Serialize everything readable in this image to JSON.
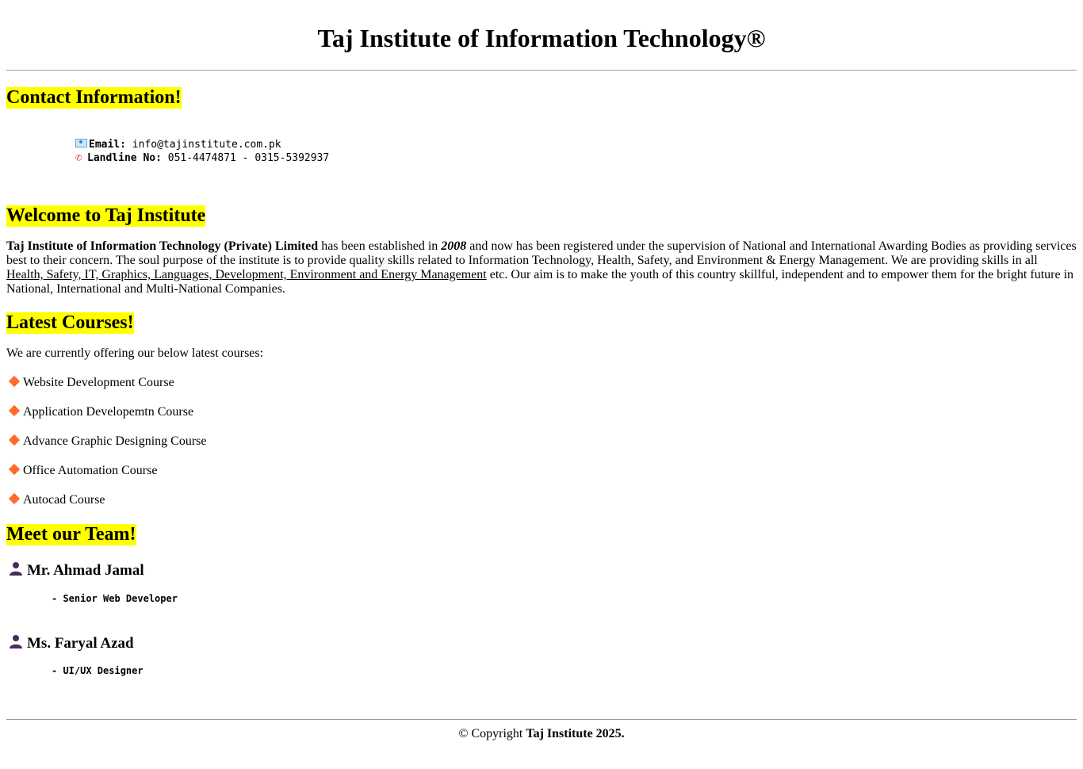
{
  "header": {
    "title": "Taj Institute of Information Technology®"
  },
  "contact": {
    "heading": "Contact Information!",
    "email_label": "Email:",
    "email_value": "info@tajinstitute.com.pk",
    "phone_label": "Landline No:",
    "phone_value": "051-4474871 - 0315-5392937",
    "icons": [
      "email-icon",
      "phone-icon"
    ]
  },
  "welcome": {
    "heading": "Welcome to Taj Institute",
    "company": "Taj Institute of Information Technology (Private) Limited",
    "text_1": " has been established in ",
    "year": "2008",
    "text_2": " and now has been registered under the supervision of National and International Awarding Bodies as providing services best to their concern. The soul purpose of the institute is to provide quality skills related to Information Technology, Health, Safety, and Environment & Energy Management. We are providing skills in all ",
    "skills_link": "Health, Safety, IT, Graphics, Languages, Development, Environment and Energy Management",
    "text_3": " etc. Our aim is to make the youth of this country skillful, independent and to empower them for the bright future in National, International and Multi-National Companies."
  },
  "courses": {
    "heading": "Latest Courses!",
    "intro": "We are currently offering our below latest courses:",
    "items": [
      "Website Development Course",
      "Application Developemtn Course",
      "Advance Graphic Designing Course",
      "Office Automation Course",
      "Autocad Course"
    ],
    "bullet_color": "#ff6b2b"
  },
  "team": {
    "heading": "Meet our Team!",
    "members": [
      {
        "name": "Mr. Ahmad Jamal",
        "role": "- Senior Web Developer"
      },
      {
        "name": "Ms. Faryal Azad",
        "role": "- UI/UX Designer"
      }
    ],
    "icon_color": "#4b2a5c"
  },
  "footer": {
    "prefix": "© Copyright ",
    "brand": "Taj Institute 2025."
  },
  "colors": {
    "highlight": "#ffff00",
    "rule": "#9a9a9a"
  }
}
